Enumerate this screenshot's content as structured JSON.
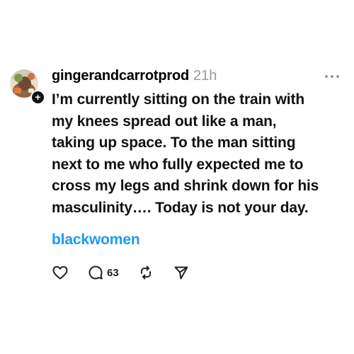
{
  "post": {
    "author": {
      "username": "gingerandcarrotprod",
      "avatar_icon": "profile-avatar",
      "follow_icon": "plus-icon",
      "follow_symbol": "+"
    },
    "timestamp": "21h",
    "more_icon": "more-dots-icon",
    "body_lines": [
      "I’m currently sitting on the train with",
      "my knees spread out like a man,",
      "taking up space. To the man sitting",
      "next to me who fully expected me to",
      "cross my legs and shrink down for his",
      "masculinity…. Today is not your day."
    ],
    "hashtag": "blackwomen",
    "actions": {
      "like_icon": "heart-icon",
      "reply_icon": "comment-icon",
      "reply_count": "63",
      "repost_icon": "repost-icon",
      "share_icon": "send-icon"
    },
    "colors": {
      "text": "#111111",
      "muted": "#9a9a9a",
      "link": "#1d9bf0"
    }
  }
}
